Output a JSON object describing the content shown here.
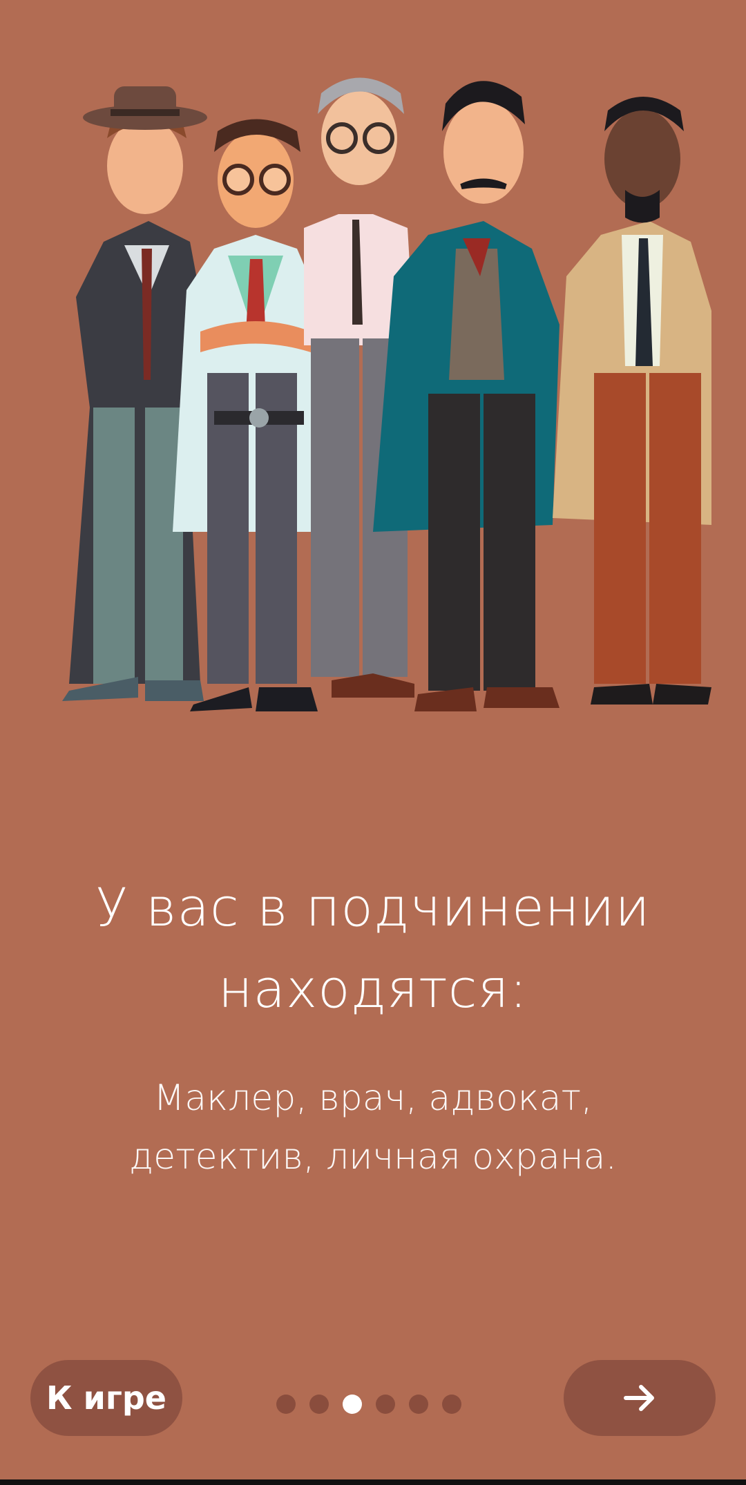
{
  "onboarding": {
    "title_lines": [
      "У вас в подчинении",
      "находятся:"
    ],
    "subtitle_lines": [
      "Маклер, врач, адвокат,",
      "детектив, личная охрана."
    ],
    "illustration_icon": "five-characters-illustration"
  },
  "footer": {
    "to_game_label": "К игре",
    "next_icon": "arrow-right-icon",
    "pages_total": 6,
    "current_page": 3
  },
  "colors": {
    "background": "#b26c53",
    "button": "#8f5242",
    "dot_inactive": "#8a4d3d",
    "dot_active": "#ffffff",
    "text": "#ffffff"
  }
}
